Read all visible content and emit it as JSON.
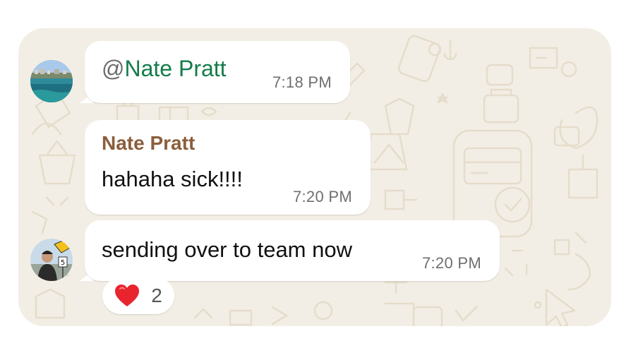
{
  "theme": {
    "wallpaper": "#f3eee5",
    "bubble": "#ffffff",
    "mention_color": "#147c4a",
    "sender_color": "#8b5e3c",
    "timestamp_color": "#6f6f6f",
    "heart_color": "#e8242f"
  },
  "messages": [
    {
      "at": "@",
      "mention": "Nate Pratt",
      "time": "7:18 PM",
      "avatar_icon": "avatar-ocean-photo"
    },
    {
      "sender": "Nate Pratt",
      "text": "hahaha sick!!!!",
      "time": "7:20 PM"
    },
    {
      "text": "sending over to team now",
      "time": "7:20 PM",
      "avatar_icon": "avatar-person-photo",
      "reaction": {
        "emoji_icon": "red-heart-icon",
        "count": "2"
      }
    }
  ]
}
